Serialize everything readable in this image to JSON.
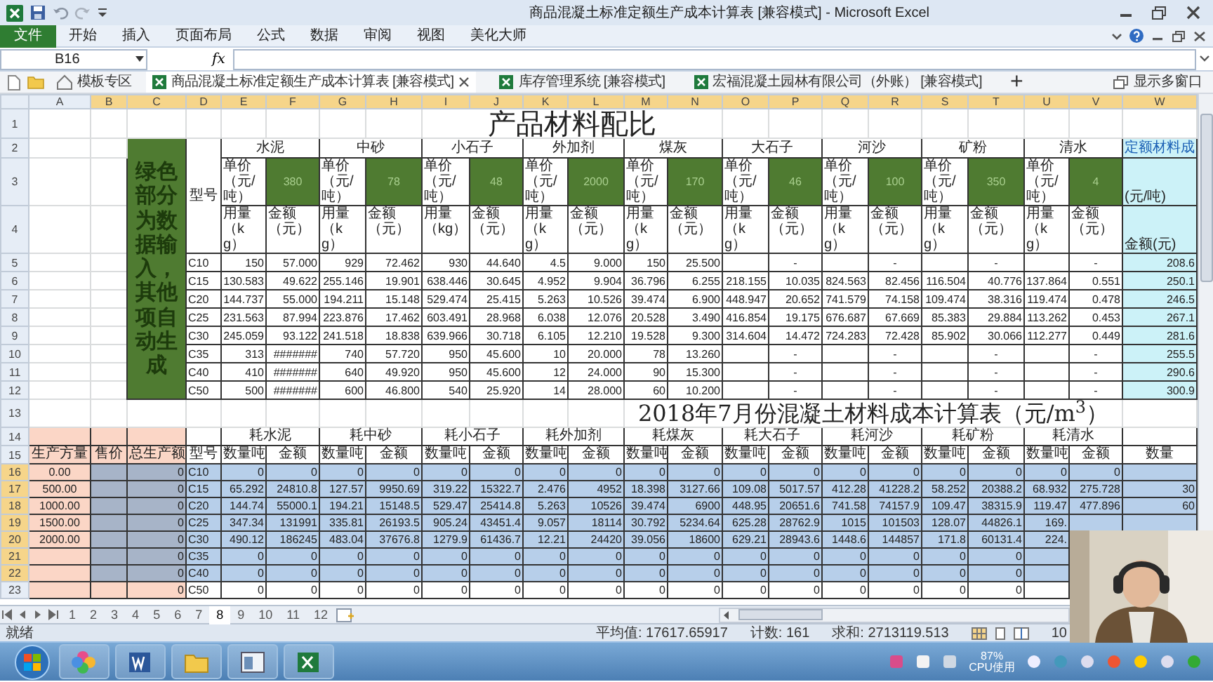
{
  "title_bar": {
    "title": "商品混凝土标准定额生产成本计算表 [兼容模式] - Microsoft Excel"
  },
  "ribbon": {
    "file_tab": "文件",
    "tabs": [
      "开始",
      "插入",
      "页面布局",
      "公式",
      "数据",
      "审阅",
      "视图",
      "美化大师"
    ]
  },
  "formula_bar": {
    "name_box": "B16",
    "function_label": "fx"
  },
  "workbook_tabs": [
    {
      "kind": "home",
      "label": "模板专区",
      "selected": false
    },
    {
      "kind": "workbook",
      "label": "商品混凝土标准定额生产成本计算表 [兼容模式]",
      "selected": true
    },
    {
      "kind": "workbook",
      "label": "库存管理系统 [兼容模式]",
      "selected": false
    },
    {
      "kind": "workbook",
      "label": "宏福混凝土园林有限公司（外账） [兼容模式]",
      "selected": false
    }
  ],
  "new_tab": "+",
  "multi_window": "显示多窗口",
  "columns": [
    {
      "label": "A",
      "selected": false
    },
    {
      "label": "B",
      "selected": true
    },
    {
      "label": "C",
      "selected": true
    },
    {
      "label": "D",
      "selected": true
    },
    {
      "label": "E",
      "selected": true
    },
    {
      "label": "F",
      "selected": true
    },
    {
      "label": "G",
      "selected": true
    },
    {
      "label": "H",
      "selected": true
    },
    {
      "label": "I",
      "selected": true
    },
    {
      "label": "J",
      "selected": true
    },
    {
      "label": "K",
      "selected": true
    },
    {
      "label": "L",
      "selected": true
    },
    {
      "label": "M",
      "selected": true
    },
    {
      "label": "N",
      "selected": true
    },
    {
      "label": "O",
      "selected": true
    },
    {
      "label": "P",
      "selected": true
    },
    {
      "label": "Q",
      "selected": true
    },
    {
      "label": "R",
      "selected": true
    },
    {
      "label": "S",
      "selected": true
    },
    {
      "label": "T",
      "selected": true
    },
    {
      "label": "U",
      "selected": true
    },
    {
      "label": "V",
      "selected": true
    },
    {
      "label": "W",
      "selected": true
    }
  ],
  "row_headers": [
    {
      "label": "1",
      "selected": false
    },
    {
      "label": "2",
      "selected": false
    },
    {
      "label": "3",
      "selected": false
    },
    {
      "label": "4",
      "selected": false
    },
    {
      "label": "5",
      "selected": false
    },
    {
      "label": "6",
      "selected": false
    },
    {
      "label": "7",
      "selected": false
    },
    {
      "label": "8",
      "selected": false
    },
    {
      "label": "9",
      "selected": false
    },
    {
      "label": "10",
      "selected": false
    },
    {
      "label": "11",
      "selected": false
    },
    {
      "label": "12",
      "selected": false
    },
    {
      "label": "13",
      "selected": false
    },
    {
      "label": "14",
      "selected": false
    },
    {
      "label": "15",
      "selected": false
    },
    {
      "label": "16",
      "selected": true
    },
    {
      "label": "17",
      "selected": true
    },
    {
      "label": "18",
      "selected": true
    },
    {
      "label": "19",
      "selected": true
    },
    {
      "label": "20",
      "selected": true
    },
    {
      "label": "21",
      "selected": true
    },
    {
      "label": "22",
      "selected": true
    },
    {
      "label": "23",
      "selected": false
    }
  ],
  "mix_table": {
    "title": "产品材料配比",
    "note": "绿色部分为数据输入，其他项自动生成",
    "type_header": "型号",
    "materials": [
      {
        "name": "水泥",
        "price_label": "单价（元/吨）",
        "price": "380",
        "qty_label": "用量（kg）",
        "amount_label": "金额（元）"
      },
      {
        "name": "中砂",
        "price_label": "单价（元/吨）",
        "price": "78",
        "qty_label": "用量（kg）",
        "amount_label": "金额（元）"
      },
      {
        "name": "小石子",
        "price_label": "单价（元/吨）",
        "price": "48",
        "qty_label": "用量（kg）",
        "amount_label": "金额（元）"
      },
      {
        "name": "外加剂",
        "price_label": "单价（元/吨）",
        "price": "2000",
        "qty_label": "用量（kg）",
        "amount_label": "金额（元）"
      },
      {
        "name": "煤灰",
        "price_label": "单价（元/吨）",
        "price": "170",
        "qty_label": "用量（kg）",
        "amount_label": "金额（元）"
      },
      {
        "name": "大石子",
        "price_label": "单价（元/吨）",
        "price": "46",
        "qty_label": "用量（kg）",
        "amount_label": "金额（元）"
      },
      {
        "name": "河沙",
        "price_label": "单价（元/吨）",
        "price": "100",
        "qty_label": "用量（kg）",
        "amount_label": "金额（元）"
      },
      {
        "name": "矿粉",
        "price_label": "单价（元/吨）",
        "price": "350",
        "qty_label": "用量（kg）",
        "amount_label": "金额（元）"
      },
      {
        "name": "清水",
        "price_label": "单价（元/吨）",
        "price": "4",
        "qty_label": "用量（kg）",
        "amount_label": "金额（元）"
      }
    ],
    "total": {
      "name": "定额材料成",
      "unit_label": "(元/吨)",
      "amount_label": "金额(元)"
    },
    "rows": [
      {
        "type": "C10",
        "cells": [
          "150",
          "57.000",
          "929",
          "72.462",
          "930",
          "44.640",
          "4.5",
          "9.000",
          "150",
          "25.500",
          null,
          "-",
          null,
          "-",
          null,
          "-",
          null,
          "-"
        ],
        "total": "208.6"
      },
      {
        "type": "C15",
        "cells": [
          "130.583",
          "49.622",
          "255.146",
          "19.901",
          "638.446",
          "30.645",
          "4.952",
          "9.904",
          "36.796",
          "6.255",
          "218.155",
          "10.035",
          "824.563",
          "82.456",
          "116.504",
          "40.776",
          "137.864",
          "0.551"
        ],
        "total": "250.1"
      },
      {
        "type": "C20",
        "cells": [
          "144.737",
          "55.000",
          "194.211",
          "15.148",
          "529.474",
          "25.415",
          "5.263",
          "10.526",
          "39.474",
          "6.900",
          "448.947",
          "20.652",
          "741.579",
          "74.158",
          "109.474",
          "38.316",
          "119.474",
          "0.478"
        ],
        "total": "246.5"
      },
      {
        "type": "C25",
        "cells": [
          "231.563",
          "87.994",
          "223.876",
          "17.462",
          "603.491",
          "28.968",
          "6.038",
          "12.076",
          "20.528",
          "3.490",
          "416.854",
          "19.175",
          "676.687",
          "67.669",
          "85.383",
          "29.884",
          "113.262",
          "0.453"
        ],
        "total": "267.1"
      },
      {
        "type": "C30",
        "cells": [
          "245.059",
          "93.122",
          "241.518",
          "18.838",
          "639.966",
          "30.718",
          "6.105",
          "12.210",
          "19.528",
          "9.300",
          "314.604",
          "14.472",
          "724.283",
          "72.428",
          "85.902",
          "30.066",
          "112.277",
          "0.449"
        ],
        "total": "281.6"
      },
      {
        "type": "C35",
        "cells": [
          "313",
          "#######",
          "740",
          "57.720",
          "950",
          "45.600",
          "10",
          "20.000",
          "78",
          "13.260",
          null,
          "-",
          null,
          "-",
          null,
          "-",
          null,
          "-"
        ],
        "total": "255.5"
      },
      {
        "type": "C40",
        "cells": [
          "410",
          "#######",
          "640",
          "49.920",
          "950",
          "45.600",
          "12",
          "24.000",
          "90",
          "15.300",
          null,
          "-",
          null,
          "-",
          null,
          "-",
          null,
          "-"
        ],
        "total": "290.6"
      },
      {
        "type": "C50",
        "cells": [
          "500",
          "#######",
          "600",
          "46.800",
          "540",
          "25.920",
          "14",
          "28.000",
          "60",
          "10.200",
          null,
          "-",
          null,
          "-",
          null,
          "-",
          null,
          "-"
        ],
        "total": "300.9"
      }
    ]
  },
  "cost_table": {
    "title": "2018年7月份混凝土材料成本计算表（元/m$^{3}$）",
    "input_headers": [
      "生产方量",
      "售价",
      "总生产额"
    ],
    "type_header": "型号",
    "materials": [
      {
        "name": "耗水泥",
        "qty_label": "数量吨",
        "amount_label": "金额"
      },
      {
        "name": "耗中砂",
        "qty_label": "数量吨",
        "amount_label": "金额"
      },
      {
        "name": "耗小石子",
        "qty_label": "数量吨",
        "amount_label": "金额"
      },
      {
        "name": "耗外加剂",
        "qty_label": "数量吨",
        "amount_label": "金额"
      },
      {
        "name": "耗煤灰",
        "qty_label": "数量吨",
        "amount_label": "金额"
      },
      {
        "name": "耗大石子",
        "qty_label": "数量吨",
        "amount_label": "金额"
      },
      {
        "name": "耗河沙",
        "qty_label": "数量吨",
        "amount_label": "金额"
      },
      {
        "name": "耗矿粉",
        "qty_label": "数量吨",
        "amount_label": "金额"
      },
      {
        "name": "耗清水",
        "qty_label": "数量吨",
        "amount_label": "金额"
      }
    ],
    "last_header": "数量",
    "rows": [
      {
        "volume": "0.00",
        "price": null,
        "total": "0",
        "type": "C10",
        "cells": [
          "0",
          "0",
          "0",
          "0",
          "0",
          "0",
          "0",
          "0",
          "0",
          "0",
          "0",
          "0",
          "0",
          "0",
          "0",
          "0",
          "0",
          "0"
        ],
        "last": null
      },
      {
        "volume": "500.00",
        "price": null,
        "total": "0",
        "type": "C15",
        "cells": [
          "65.292",
          "24810.8",
          "127.57",
          "9950.69",
          "319.22",
          "15322.7",
          "2.476",
          "4952",
          "18.398",
          "3127.66",
          "109.08",
          "5017.57",
          "412.28",
          "41228.2",
          "58.252",
          "20388.2",
          "68.932",
          "275.728"
        ],
        "last": "30"
      },
      {
        "volume": "1000.00",
        "price": null,
        "total": "0",
        "type": "C20",
        "cells": [
          "144.74",
          "55000.1",
          "194.21",
          "15148.5",
          "529.47",
          "25414.8",
          "5.263",
          "10526",
          "39.474",
          "6900",
          "448.95",
          "20651.6",
          "741.58",
          "74157.9",
          "109.47",
          "38315.9",
          "119.47",
          "477.896"
        ],
        "last": "60"
      },
      {
        "volume": "1500.00",
        "price": null,
        "total": "0",
        "type": "C25",
        "cells": [
          "347.34",
          "131991",
          "335.81",
          "26193.5",
          "905.24",
          "43451.4",
          "9.057",
          "18114",
          "30.792",
          "5234.64",
          "625.28",
          "28762.9",
          "1015",
          "101503",
          "128.07",
          "44826.1",
          "169.",
          null
        ],
        "last": null
      },
      {
        "volume": "2000.00",
        "price": null,
        "total": "0",
        "type": "C30",
        "cells": [
          "490.12",
          "186245",
          "483.04",
          "37676.8",
          "1279.9",
          "61436.7",
          "12.21",
          "24420",
          "39.056",
          "18600",
          "629.21",
          "28943.6",
          "1448.6",
          "144857",
          "171.8",
          "60131.4",
          "224.",
          null
        ],
        "last": null
      },
      {
        "volume": null,
        "price": null,
        "total": "0",
        "type": "C35",
        "cells": [
          "0",
          "0",
          "0",
          "0",
          "0",
          "0",
          "0",
          "0",
          "0",
          "0",
          "0",
          "0",
          "0",
          "0",
          "0",
          "0",
          null,
          null
        ],
        "last": null
      },
      {
        "volume": null,
        "price": null,
        "total": "0",
        "type": "C40",
        "cells": [
          "0",
          "0",
          "0",
          "0",
          "0",
          "0",
          "0",
          "0",
          "0",
          "0",
          "0",
          "0",
          "0",
          "0",
          "0",
          "0",
          null,
          null
        ],
        "last": null
      },
      {
        "volume": null,
        "price": null,
        "total": "0",
        "type": "C50",
        "cells": [
          "0",
          "0",
          "0",
          "0",
          "0",
          "0",
          "0",
          "0",
          "0",
          "0",
          "0",
          "0",
          "0",
          "0",
          "0",
          "0",
          null,
          null
        ],
        "last": null
      }
    ]
  },
  "sheet_tabs": [
    {
      "label": "1",
      "selected": false
    },
    {
      "label": "2",
      "selected": false
    },
    {
      "label": "3",
      "selected": false
    },
    {
      "label": "4",
      "selected": false
    },
    {
      "label": "5",
      "selected": false
    },
    {
      "label": "6",
      "selected": false
    },
    {
      "label": "7",
      "selected": false
    },
    {
      "label": "8",
      "selected": true
    },
    {
      "label": "9",
      "selected": false
    },
    {
      "label": "10",
      "selected": false
    },
    {
      "label": "11",
      "selected": false
    },
    {
      "label": "12",
      "selected": false
    }
  ],
  "status_bar": {
    "mode": "就绪",
    "average": "平均值: 17617.65917",
    "count": "计数: 161",
    "sum": "求和: 2713119.513",
    "zoom": "10"
  },
  "taskbar": {
    "cpu_value": "87%",
    "cpu_label": "CPU使用"
  }
}
